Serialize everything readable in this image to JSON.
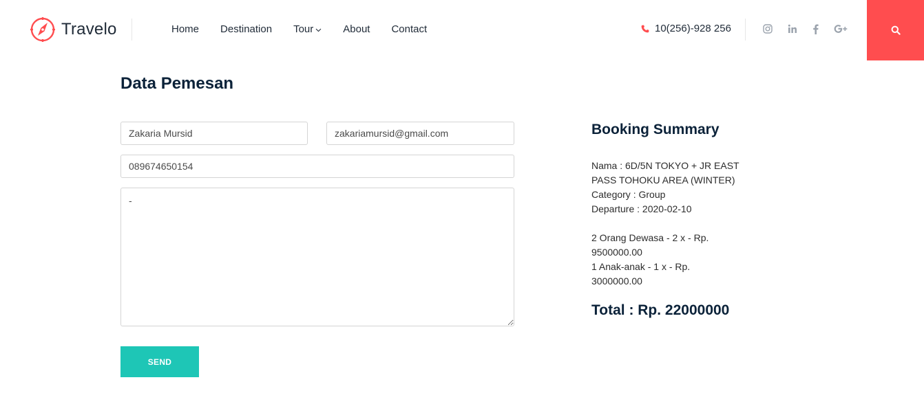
{
  "brand": {
    "name": "Travelo",
    "accent": "#ff4d4f"
  },
  "nav": {
    "items": [
      {
        "label": "Home"
      },
      {
        "label": "Destination"
      },
      {
        "label": "Tour"
      },
      {
        "label": "About"
      },
      {
        "label": "Contact"
      }
    ]
  },
  "contact": {
    "phone": "10(256)-928 256",
    "phone_icon": "phone-icon"
  },
  "social": [
    "instagram-icon",
    "linkedin-icon",
    "facebook-icon",
    "google-plus-icon"
  ],
  "search": {
    "icon": "search-icon",
    "color": "#ff4d4f"
  },
  "form": {
    "title": "Data Pemesan",
    "name_value": "Zakaria Mursid",
    "email_value": "zakariamursid@gmail.com",
    "phone_value": "089674650154",
    "message_value": "-",
    "send_label": "SEND",
    "send_color": "#1ec6b6"
  },
  "summary": {
    "title": "Booking Summary",
    "nama_line1": "Nama : 6D/5N TOKYO + JR EAST",
    "nama_line2": "PASS TOHOKU AREA (WINTER)",
    "category": "Category : Group",
    "departure": "Departure : 2020-02-10",
    "adult_line1": "2 Orang Dewasa - 2 x - Rp.",
    "adult_line2": "9500000.00",
    "child_line1": "1 Anak-anak - 1 x - Rp.",
    "child_line2": "3000000.00",
    "total": "Total : Rp. 22000000"
  }
}
